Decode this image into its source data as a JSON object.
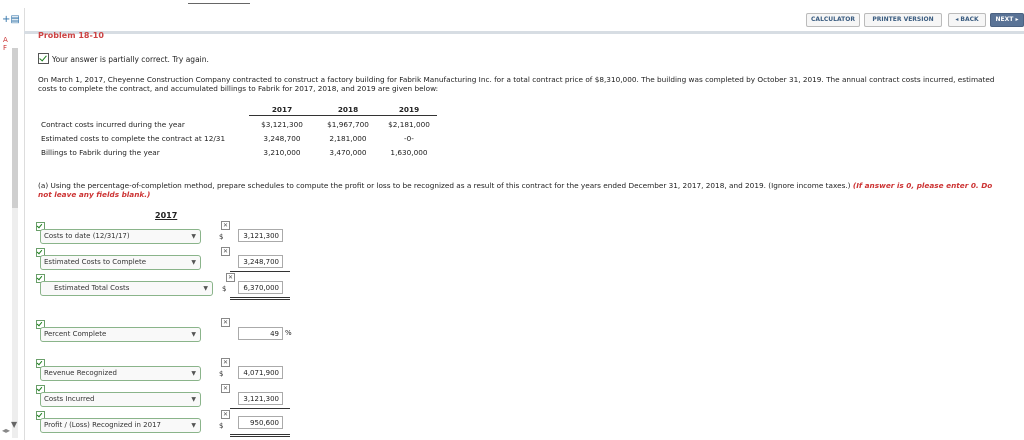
{
  "toolbar": {
    "calculator": "CALCULATOR",
    "printer_version": "PRINTER VERSION",
    "back": "◂ BACK",
    "next": "NEXT ▸"
  },
  "problem": {
    "title": "Problem 18-10",
    "status": "Your answer is partially correct.  Try again.",
    "intro": "On March 1, 2017, Cheyenne Construction Company contracted to construct a factory building for Fabrik Manufacturing Inc. for a total contract price of $8,310,000. The building was completed by October 31, 2019. The annual contract costs incurred, estimated costs to complete the contract, and accumulated billings to Fabrik for 2017, 2018, and 2019 are given below:"
  },
  "table": {
    "headers": [
      "2017",
      "2018",
      "2019"
    ],
    "rows": [
      {
        "label": "Contract costs incurred during the year",
        "v": [
          "$3,121,300",
          "$1,967,700",
          "$2,181,000"
        ]
      },
      {
        "label": "Estimated costs to complete the contract at 12/31",
        "v": [
          "3,248,700",
          "2,181,000",
          "-0-"
        ]
      },
      {
        "label": "Billings to Fabrik during the year",
        "v": [
          "3,210,000",
          "3,470,000",
          "1,630,000"
        ]
      }
    ]
  },
  "question": {
    "text": "(a) Using the percentage-of-completion method, prepare schedules to compute the profit or loss to be recognized as a result of this contract for the years ended December 31, 2017, 2018, and 2019. (Ignore income taxes.) ",
    "note": "(If answer is 0, please enter 0. Do not leave any fields blank.)"
  },
  "schedule": {
    "year": "2017",
    "rows": [
      {
        "label": "Costs to date (12/31/17)",
        "value": "3,121,300",
        "dollar": "$"
      },
      {
        "label": "Estimated Costs to Complete",
        "value": "3,248,700",
        "dollar": ""
      },
      {
        "label": "Estimated Total Costs",
        "value": "6,370,000",
        "dollar": "$"
      },
      {
        "label": "Percent Complete",
        "value": "49",
        "dollar": "",
        "suffix": "%"
      },
      {
        "label": "Revenue Recognized",
        "value": "4,071,900",
        "dollar": "$"
      },
      {
        "label": "Costs Incurred",
        "value": "3,121,300",
        "dollar": ""
      },
      {
        "label": "Profit / (Loss) Recognized in 2017",
        "value": "950,600",
        "dollar": "$"
      }
    ]
  },
  "sidebar": {
    "letters": [
      "A",
      "F"
    ]
  }
}
